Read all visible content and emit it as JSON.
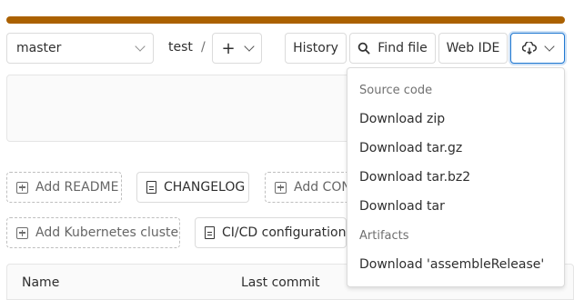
{
  "toolbar": {
    "branch": "master",
    "path_segment": "test",
    "path_separator": "/",
    "add_label": "+",
    "history_label": "History",
    "find_file_label": "Find file",
    "web_ide_label": "Web IDE"
  },
  "quick_actions": {
    "add_readme": "Add README",
    "changelog": "CHANGELOG",
    "add_contributing": "Add CONT",
    "add_kubernetes": "Add Kubernetes cluster",
    "cicd_config": "CI/CD configuration"
  },
  "table": {
    "columns": [
      "Name",
      "Last commit"
    ]
  },
  "download_menu": {
    "source_header": "Source code",
    "items": [
      "Download zip",
      "Download tar.gz",
      "Download tar.bz2",
      "Download tar"
    ],
    "artifacts_header": "Artifacts",
    "artifact_item": "Download 'assembleRelease'"
  },
  "colors": {
    "progress": "#ab6100",
    "focus_border": "#1f78d1"
  },
  "icons": [
    "chevron-down-icon",
    "search-icon",
    "cloud-download-icon",
    "plus-square-icon",
    "document-icon"
  ]
}
